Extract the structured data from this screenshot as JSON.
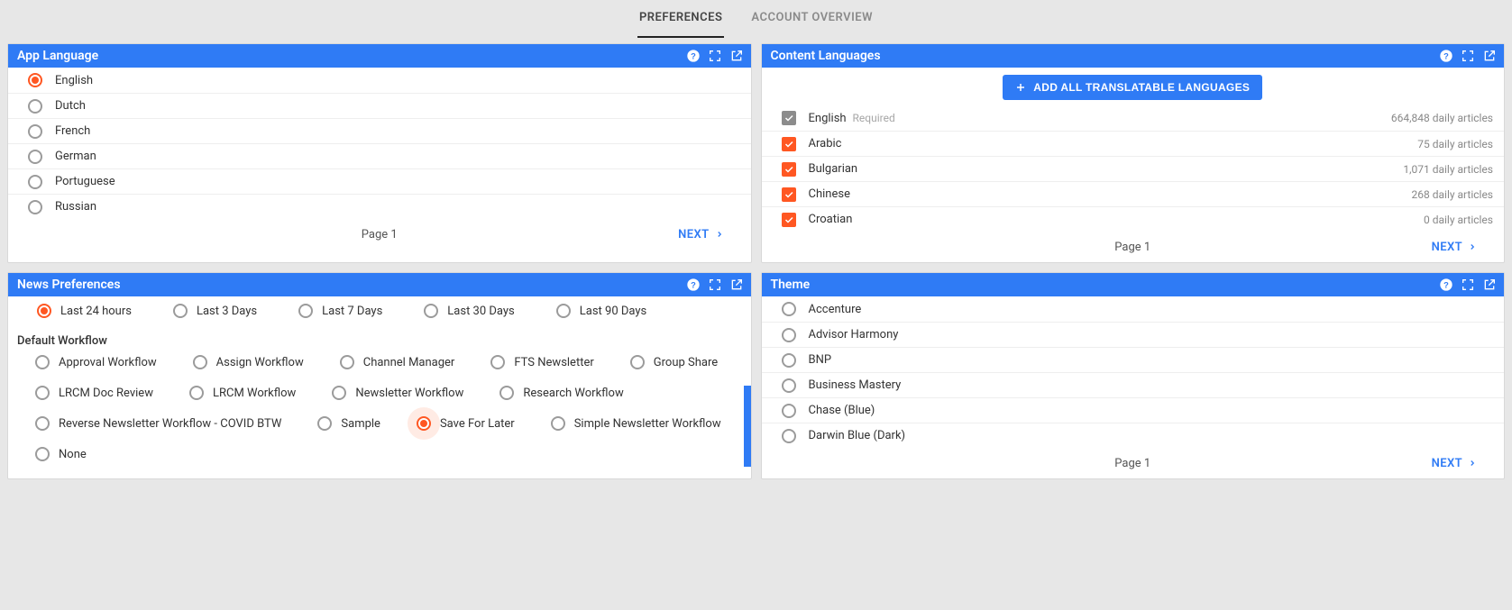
{
  "tabs": {
    "preferences": "PREFERENCES",
    "account": "ACCOUNT OVERVIEW"
  },
  "appLanguage": {
    "title": "App Language",
    "items": [
      "English",
      "Dutch",
      "French",
      "German",
      "Portuguese",
      "Russian"
    ],
    "selected": "English",
    "page": "Page 1",
    "next": "NEXT"
  },
  "contentLanguages": {
    "title": "Content Languages",
    "addButton": "ADD ALL TRANSLATABLE LANGUAGES",
    "requiredLabel": "Required",
    "items": [
      {
        "name": "English",
        "count": "664,848 daily articles",
        "required": true
      },
      {
        "name": "Arabic",
        "count": "75 daily articles"
      },
      {
        "name": "Bulgarian",
        "count": "1,071 daily articles"
      },
      {
        "name": "Chinese",
        "count": "268 daily articles"
      },
      {
        "name": "Croatian",
        "count": "0 daily articles"
      }
    ],
    "page": "Page 1",
    "next": "NEXT"
  },
  "newsPrefs": {
    "title": "News Preferences",
    "dateOptions": [
      "Last 24 hours",
      "Last 3 Days",
      "Last 7 Days",
      "Last 30 Days",
      "Last 90 Days"
    ],
    "dateSelected": "Last 24 hours",
    "workflowLabel": "Default Workflow",
    "workflows": [
      "Approval Workflow",
      "Assign Workflow",
      "Channel Manager",
      "FTS Newsletter",
      "Group Share",
      "LRCM Doc Review",
      "LRCM Workflow",
      "Newsletter Workflow",
      "Research Workflow",
      "Reverse Newsletter Workflow - COVID BTW",
      "Sample",
      "Save For Later",
      "Simple Newsletter Workflow",
      "None"
    ],
    "workflowSelected": "Save For Later"
  },
  "theme": {
    "title": "Theme",
    "items": [
      "Accenture",
      "Advisor Harmony",
      "BNP",
      "Business Mastery",
      "Chase (Blue)",
      "Darwin Blue (Dark)"
    ],
    "selected": "",
    "page": "Page 1",
    "next": "NEXT"
  }
}
